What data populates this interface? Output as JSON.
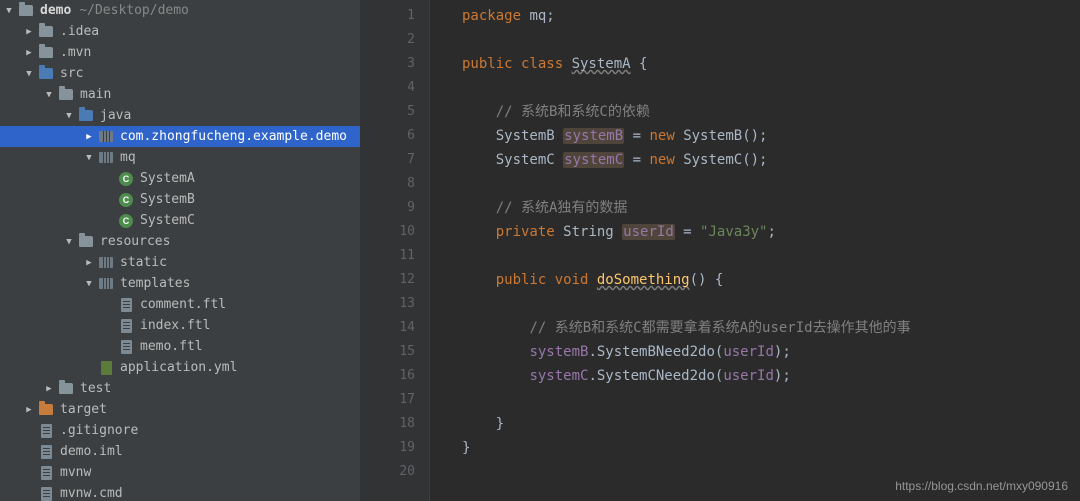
{
  "watermark": "https://blog.csdn.net/mxy090916",
  "tree": [
    {
      "depth": 0,
      "chev": "down",
      "icon": "folder",
      "label": "demo",
      "extra": "~/Desktop/demo",
      "selected": false,
      "bold": true
    },
    {
      "depth": 1,
      "chev": "right",
      "icon": "folder",
      "label": ".idea"
    },
    {
      "depth": 1,
      "chev": "right",
      "icon": "folder",
      "label": ".mvn"
    },
    {
      "depth": 1,
      "chev": "down",
      "icon": "folder-blue",
      "label": "src"
    },
    {
      "depth": 2,
      "chev": "down",
      "icon": "folder",
      "label": "main"
    },
    {
      "depth": 3,
      "chev": "down",
      "icon": "folder-blue",
      "label": "java"
    },
    {
      "depth": 4,
      "chev": "right",
      "icon": "pkg",
      "label": "com.zhongfucheng.example.demo",
      "selected": true
    },
    {
      "depth": 4,
      "chev": "down",
      "icon": "pkg",
      "label": "mq"
    },
    {
      "depth": 5,
      "chev": "none",
      "icon": "class",
      "label": "SystemA"
    },
    {
      "depth": 5,
      "chev": "none",
      "icon": "class",
      "label": "SystemB"
    },
    {
      "depth": 5,
      "chev": "none",
      "icon": "class",
      "label": "SystemC"
    },
    {
      "depth": 3,
      "chev": "down",
      "icon": "folder",
      "label": "resources"
    },
    {
      "depth": 4,
      "chev": "right",
      "icon": "pkg",
      "label": "static"
    },
    {
      "depth": 4,
      "chev": "down",
      "icon": "pkg",
      "label": "templates"
    },
    {
      "depth": 5,
      "chev": "none",
      "icon": "file",
      "label": "comment.ftl"
    },
    {
      "depth": 5,
      "chev": "none",
      "icon": "file",
      "label": "index.ftl"
    },
    {
      "depth": 5,
      "chev": "none",
      "icon": "file",
      "label": "memo.ftl"
    },
    {
      "depth": 4,
      "chev": "none",
      "icon": "yml",
      "label": "application.yml"
    },
    {
      "depth": 2,
      "chev": "right",
      "icon": "folder",
      "label": "test"
    },
    {
      "depth": 1,
      "chev": "right",
      "icon": "folder-orange",
      "label": "target"
    },
    {
      "depth": 1,
      "chev": "none",
      "icon": "file",
      "label": ".gitignore"
    },
    {
      "depth": 1,
      "chev": "none",
      "icon": "file",
      "label": "demo.iml"
    },
    {
      "depth": 1,
      "chev": "none",
      "icon": "file",
      "label": "mvnw"
    },
    {
      "depth": 1,
      "chev": "none",
      "icon": "file",
      "label": "mvnw.cmd"
    }
  ],
  "code": {
    "lines": [
      [
        {
          "t": "package ",
          "c": "kw"
        },
        {
          "t": "mq;",
          "c": "ty"
        }
      ],
      [],
      [
        {
          "t": "public class ",
          "c": "kw"
        },
        {
          "t": "SystemA",
          "c": "ty wavy"
        },
        {
          "t": " {",
          "c": "ty"
        }
      ],
      [],
      [
        {
          "t": "    ",
          "c": ""
        },
        {
          "t": "// 系统B和系统C的依赖",
          "c": "cm"
        }
      ],
      [
        {
          "t": "    ",
          "c": ""
        },
        {
          "t": "SystemB ",
          "c": "ty"
        },
        {
          "t": "systemB",
          "c": "fld hl"
        },
        {
          "t": " = ",
          "c": "ty"
        },
        {
          "t": "new ",
          "c": "kw"
        },
        {
          "t": "SystemB();",
          "c": "ty"
        }
      ],
      [
        {
          "t": "    ",
          "c": ""
        },
        {
          "t": "SystemC ",
          "c": "ty"
        },
        {
          "t": "systemC",
          "c": "fld hl"
        },
        {
          "t": " = ",
          "c": "ty"
        },
        {
          "t": "new ",
          "c": "kw"
        },
        {
          "t": "SystemC();",
          "c": "ty"
        }
      ],
      [],
      [
        {
          "t": "    ",
          "c": ""
        },
        {
          "t": "// 系统A独有的数据",
          "c": "cm"
        }
      ],
      [
        {
          "t": "    ",
          "c": ""
        },
        {
          "t": "private ",
          "c": "kw"
        },
        {
          "t": "String ",
          "c": "ty"
        },
        {
          "t": "userId",
          "c": "fld hl"
        },
        {
          "t": " = ",
          "c": "ty"
        },
        {
          "t": "\"Java3y\"",
          "c": "str"
        },
        {
          "t": ";",
          "c": "ty"
        }
      ],
      [],
      [
        {
          "t": "    ",
          "c": ""
        },
        {
          "t": "public void ",
          "c": "kw"
        },
        {
          "t": "doSomething",
          "c": "fn wavy"
        },
        {
          "t": "() {",
          "c": "ty"
        }
      ],
      [],
      [
        {
          "t": "        ",
          "c": ""
        },
        {
          "t": "// 系统B和系统C都需要拿着系统A的userId去操作其他的事",
          "c": "cm"
        }
      ],
      [
        {
          "t": "        ",
          "c": ""
        },
        {
          "t": "systemB",
          "c": "fld"
        },
        {
          "t": ".SystemBNeed2do(",
          "c": "ty"
        },
        {
          "t": "userId",
          "c": "fld"
        },
        {
          "t": ");",
          "c": "ty"
        }
      ],
      [
        {
          "t": "        ",
          "c": ""
        },
        {
          "t": "systemC",
          "c": "fld"
        },
        {
          "t": ".SystemCNeed2do(",
          "c": "ty"
        },
        {
          "t": "userId",
          "c": "fld"
        },
        {
          "t": ");",
          "c": "ty"
        }
      ],
      [],
      [
        {
          "t": "    }",
          "c": "ty"
        }
      ],
      [
        {
          "t": "}",
          "c": "ty"
        }
      ],
      []
    ]
  }
}
